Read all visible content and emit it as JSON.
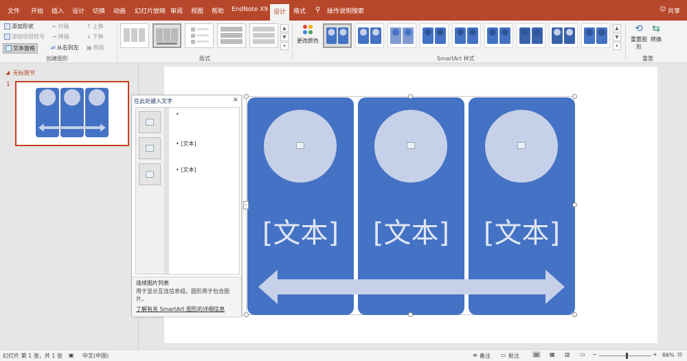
{
  "app": {
    "tabs": [
      "文件",
      "开始",
      "插入",
      "设计",
      "切换",
      "动画",
      "幻灯片放映",
      "审阅",
      "视图",
      "帮助",
      "EndNote X9",
      "设计",
      "格式"
    ],
    "active_tab": "设计",
    "tell_me": "操作说明搜索",
    "share": "共享"
  },
  "ribbon": {
    "create_graphic": {
      "add_shape": "添加形状",
      "add_bullet": "添加项目符号",
      "text_pane": "文本窗格",
      "promote": "升级",
      "demote": "降级",
      "right_to_left": "从右到左",
      "move_up": "上移",
      "move_down": "下移",
      "layout_btn": "布局",
      "label": "创建图形"
    },
    "layouts_label": "版式",
    "change_colors": "更改颜色",
    "styles_label": "SmartArt 样式",
    "reset_graphic": "重置图形",
    "convert": "转换",
    "reset_label": "重置"
  },
  "thumbnails": {
    "section": "无标题节",
    "slide_number": "1"
  },
  "text_pane": {
    "title": "在此处键入文字",
    "close": "×",
    "bullets": [
      "",
      "[文本]",
      "[文本]"
    ],
    "desc_title": "连续图片列表",
    "desc_body": "用于显示互连信息组。圆形用于包含图片。",
    "link": "了解有关 SmartArt 图形的详细信息"
  },
  "smartart": {
    "panels": [
      "[文本]",
      "[文本]",
      "[文本]"
    ],
    "colors": {
      "panel": "#4472c4",
      "circle": "#c6d0e8",
      "arrow": "#c6d0e8"
    }
  },
  "status": {
    "slide_info": "幻灯片 第 1 张，共 1 张",
    "language": "中文(中国)",
    "notes": "备注",
    "comments": "批注",
    "zoom": "86%"
  }
}
